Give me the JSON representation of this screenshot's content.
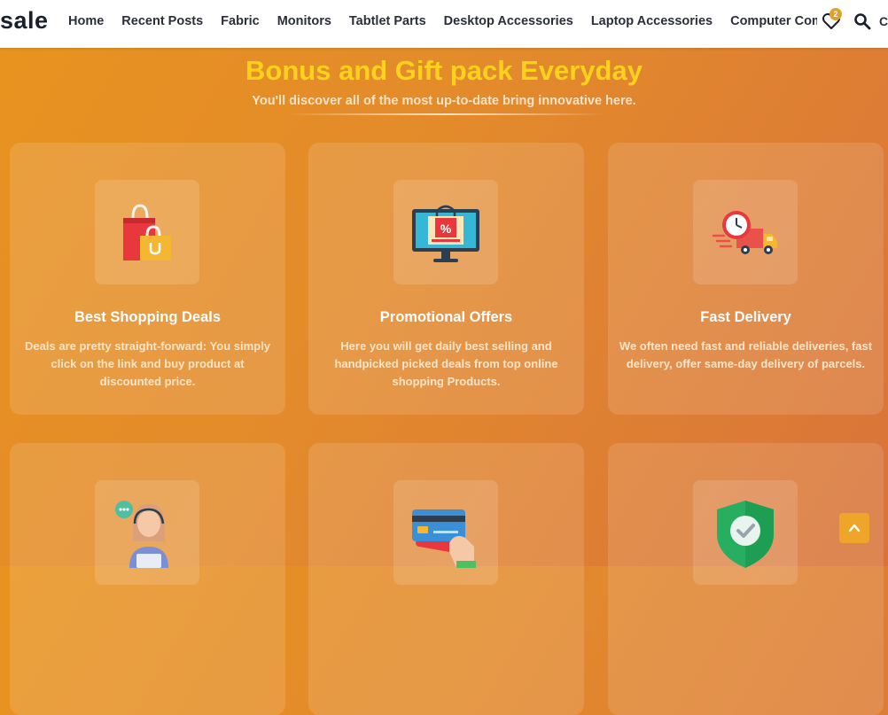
{
  "header": {
    "logo": "sale",
    "nav": [
      "Home",
      "Recent Posts",
      "Fabric",
      "Monitors",
      "Tabtlet Parts",
      "Desktop Accessories",
      "Laptop Accessories",
      "Computer Comp"
    ],
    "wishlist_count": "2",
    "cart_partial": "C"
  },
  "hero": {
    "title": "Bonus and Gift pack Everyday",
    "subtitle": "You'll discover all of the most up-to-date bring innovative here."
  },
  "features": [
    {
      "title": "Best Shopping Deals",
      "text": "Deals are pretty straight-forward: You simply click on the link and buy product at discounted price.",
      "icon": "shopping-bags-icon"
    },
    {
      "title": "Promotional Offers",
      "text": "Here you will get daily best selling and handpicked picked deals from top online shopping Products.",
      "icon": "monitor-offer-icon"
    },
    {
      "title": "Fast Delivery",
      "text": "We often need fast and reliable deliveries, fast delivery, offer same-day delivery of parcels.",
      "icon": "delivery-truck-icon"
    },
    {
      "title": "",
      "text": "",
      "icon": "support-agent-icon"
    },
    {
      "title": "",
      "text": "",
      "icon": "credit-card-icon"
    },
    {
      "title": "",
      "text": "",
      "icon": "shield-check-icon"
    }
  ],
  "colors": {
    "accent": "#ffd21e",
    "background_start": "#e8931f",
    "background_end": "#d9733a",
    "scroll_button": "#efa42a"
  }
}
